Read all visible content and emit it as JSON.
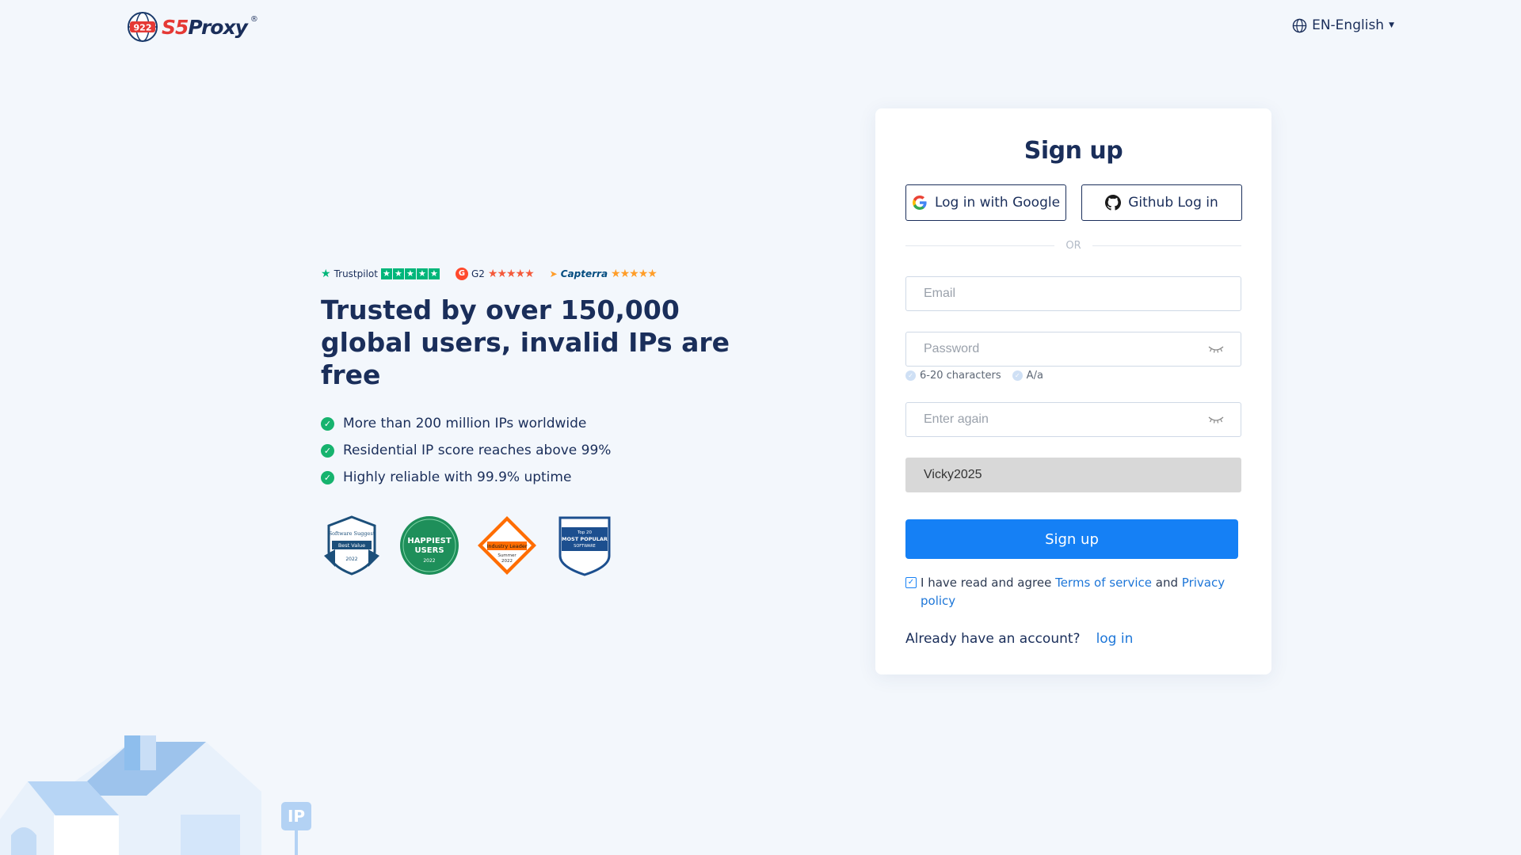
{
  "brand": {
    "name_prefix": "S5",
    "name_suffix": "Proxy",
    "mark": "®",
    "globe_text": "922"
  },
  "language": {
    "label": "EN-English"
  },
  "ratings": {
    "trustpilot": {
      "label": "Trustpilot",
      "stars": 5
    },
    "g2": {
      "label": "G2",
      "stars": 4.5
    },
    "capterra": {
      "label": "Capterra",
      "stars": 4.5
    }
  },
  "hero": {
    "title": "Trusted by over 150,000 global users, invalid IPs are free",
    "features": [
      "More than 200 million IPs worldwide",
      "Residential IP score reaches above 99%",
      "Highly reliable with 99.9% uptime"
    ]
  },
  "badges": [
    {
      "name": "software-suggest-badge",
      "line1": "Software Suggest",
      "line2": "Best Value",
      "line3": "2022"
    },
    {
      "name": "happiest-users-badge",
      "line1": "HAPPIEST",
      "line2": "USERS",
      "line3": "2022"
    },
    {
      "name": "sourceforge-badge",
      "line1": "Industry Leader",
      "line2": "Summer",
      "line3": "2022"
    },
    {
      "name": "most-popular-badge",
      "line1": "Top 20",
      "line2": "MOST POPULAR",
      "line3": "SOFTWARE"
    }
  ],
  "signup": {
    "title": "Sign up",
    "google_label": "Log in with Google",
    "github_label": "Github Log in",
    "or_label": "OR",
    "email_placeholder": "Email",
    "password_placeholder": "Password",
    "hint_length": "6-20 characters",
    "hint_case": "A/a",
    "again_placeholder": "Enter again",
    "invite_value": "Vicky2025",
    "submit_label": "Sign up",
    "agree_prefix": "I have read and agree",
    "terms_label": "Terms of service",
    "agree_and": "and",
    "privacy_label": "Privacy policy",
    "have_account": "Already have an account?",
    "login_label": "log in",
    "agree_checked": true
  },
  "illustration": {
    "ip_sign": "IP"
  },
  "colors": {
    "primary": "#1580f5",
    "navy": "#1a2e5a",
    "green": "#16b36e",
    "bg": "#f3f7fc"
  }
}
